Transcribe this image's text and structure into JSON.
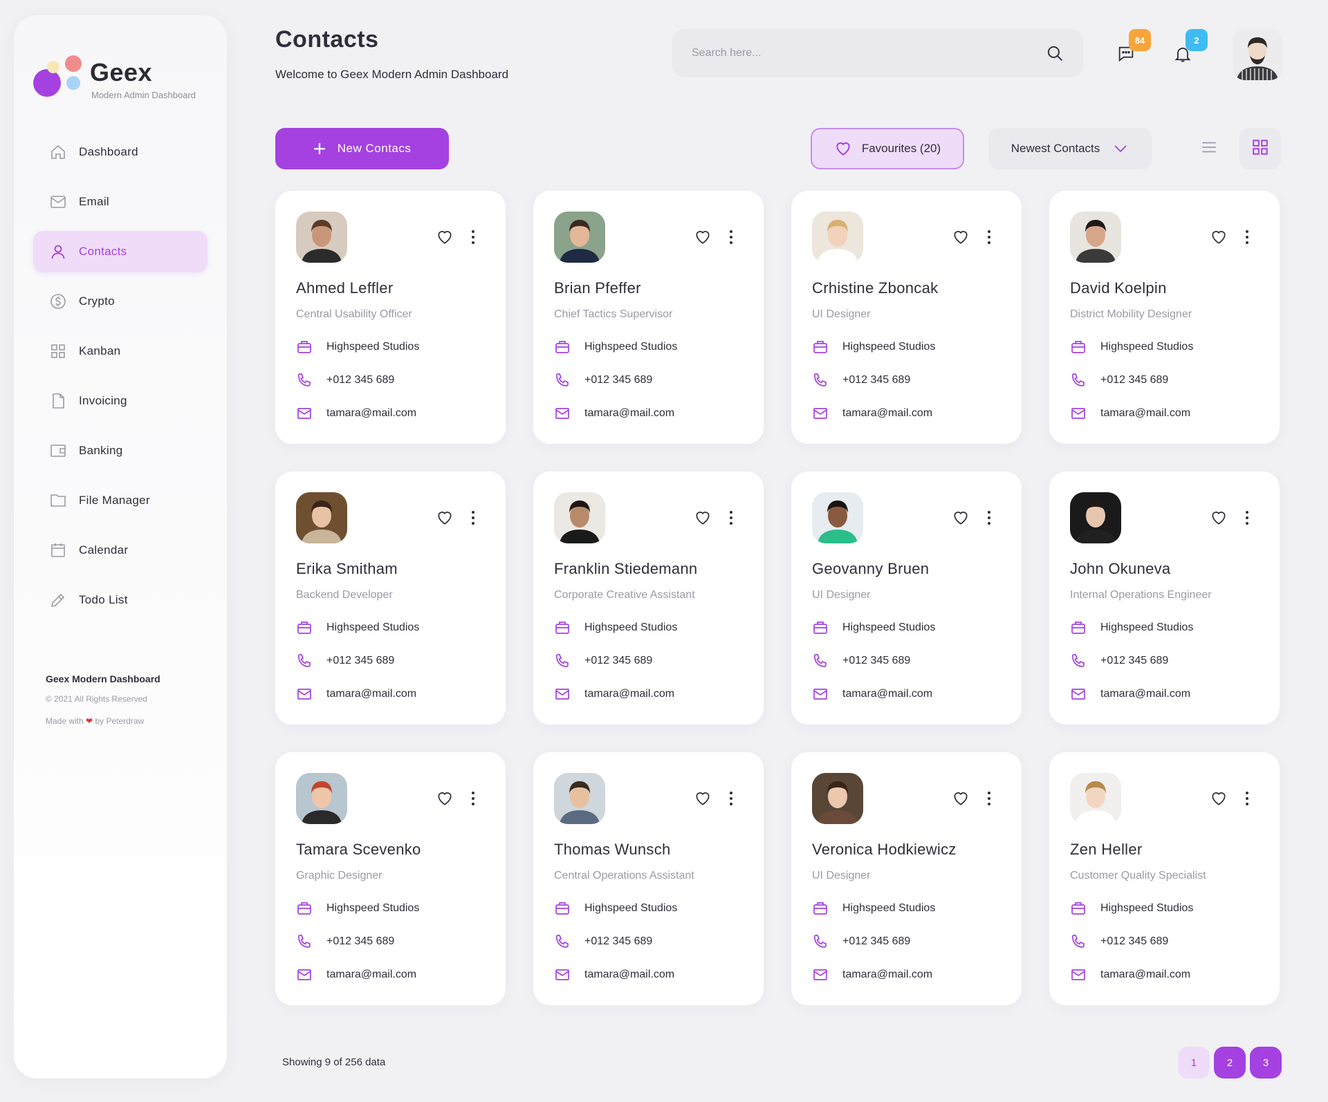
{
  "brand": {
    "name": "Geex",
    "tagline": "Modern Admin Dashboard"
  },
  "sidebar": {
    "items": [
      {
        "label": "Dashboard",
        "icon": "home-icon",
        "active": false
      },
      {
        "label": "Email",
        "icon": "mail-icon",
        "active": false
      },
      {
        "label": "Contacts",
        "icon": "user-icon",
        "active": true
      },
      {
        "label": "Crypto",
        "icon": "dollar-circle-icon",
        "active": false
      },
      {
        "label": "Kanban",
        "icon": "grid-icon",
        "active": false
      },
      {
        "label": "Invoicing",
        "icon": "document-icon",
        "active": false
      },
      {
        "label": "Banking",
        "icon": "wallet-icon",
        "active": false
      },
      {
        "label": "File Manager",
        "icon": "folder-icon",
        "active": false
      },
      {
        "label": "Calendar",
        "icon": "calendar-icon",
        "active": false
      },
      {
        "label": "Todo List",
        "icon": "pencil-icon",
        "active": false
      }
    ],
    "footer": {
      "title": "Geex Modern Dashboard",
      "copyright": "© 2021 All Rights Reserved",
      "made_prefix": "Made with",
      "made_suffix": "by Peterdraw"
    }
  },
  "header": {
    "title": "Contacts",
    "subtitle": "Welcome to Geex Modern Admin Dashboard",
    "search_placeholder": "Search here...",
    "messages_count": "84",
    "notifications_count": "2"
  },
  "toolbar": {
    "new_label": "New Contacs",
    "favourites_label": "Favourites (20)",
    "sort_label": "Newest Contacts"
  },
  "contacts": [
    {
      "name": "Ahmed Leffler",
      "role": "Central Usability Officer",
      "company": "Highspeed Studios",
      "phone": "+012 345 689",
      "email": "tamara@mail.com"
    },
    {
      "name": "Brian Pfeffer",
      "role": "Chief Tactics Supervisor",
      "company": "Highspeed Studios",
      "phone": "+012 345 689",
      "email": "tamara@mail.com"
    },
    {
      "name": "Crhistine Zboncak",
      "role": "UI Designer",
      "company": "Highspeed Studios",
      "phone": "+012 345 689",
      "email": "tamara@mail.com"
    },
    {
      "name": "David Koelpin",
      "role": "District Mobility Designer",
      "company": "Highspeed Studios",
      "phone": "+012 345 689",
      "email": "tamara@mail.com"
    },
    {
      "name": "Erika Smitham",
      "role": "Backend Developer",
      "company": "Highspeed Studios",
      "phone": "+012 345 689",
      "email": "tamara@mail.com"
    },
    {
      "name": "Franklin Stiedemann",
      "role": "Corporate Creative Assistant",
      "company": "Highspeed Studios",
      "phone": "+012 345 689",
      "email": "tamara@mail.com"
    },
    {
      "name": "Geovanny Bruen",
      "role": "UI Designer",
      "company": "Highspeed Studios",
      "phone": "+012 345 689",
      "email": "tamara@mail.com"
    },
    {
      "name": "John Okuneva",
      "role": "Internal Operations Engineer",
      "company": "Highspeed Studios",
      "phone": "+012 345 689",
      "email": "tamara@mail.com"
    },
    {
      "name": "Tamara Scevenko",
      "role": "Graphic Designer",
      "company": "Highspeed Studios",
      "phone": "+012 345 689",
      "email": "tamara@mail.com"
    },
    {
      "name": "Thomas Wunsch",
      "role": "Central Operations Assistant",
      "company": "Highspeed Studios",
      "phone": "+012 345 689",
      "email": "tamara@mail.com"
    },
    {
      "name": "Veronica Hodkiewicz",
      "role": "UI Designer",
      "company": "Highspeed Studios",
      "phone": "+012 345 689",
      "email": "tamara@mail.com"
    },
    {
      "name": "Zen Heller",
      "role": "Customer Quality Specialist",
      "company": "Highspeed Studios",
      "phone": "+012 345 689",
      "email": "tamara@mail.com"
    }
  ],
  "pagination": {
    "summary": "Showing 9 of 256 data",
    "pages": [
      "1",
      "2",
      "3"
    ]
  },
  "colors": {
    "accent": "#a441e0",
    "accent_light": "#efdcf9",
    "badge_orange": "#f7a53a",
    "badge_blue": "#3ebcf2"
  }
}
